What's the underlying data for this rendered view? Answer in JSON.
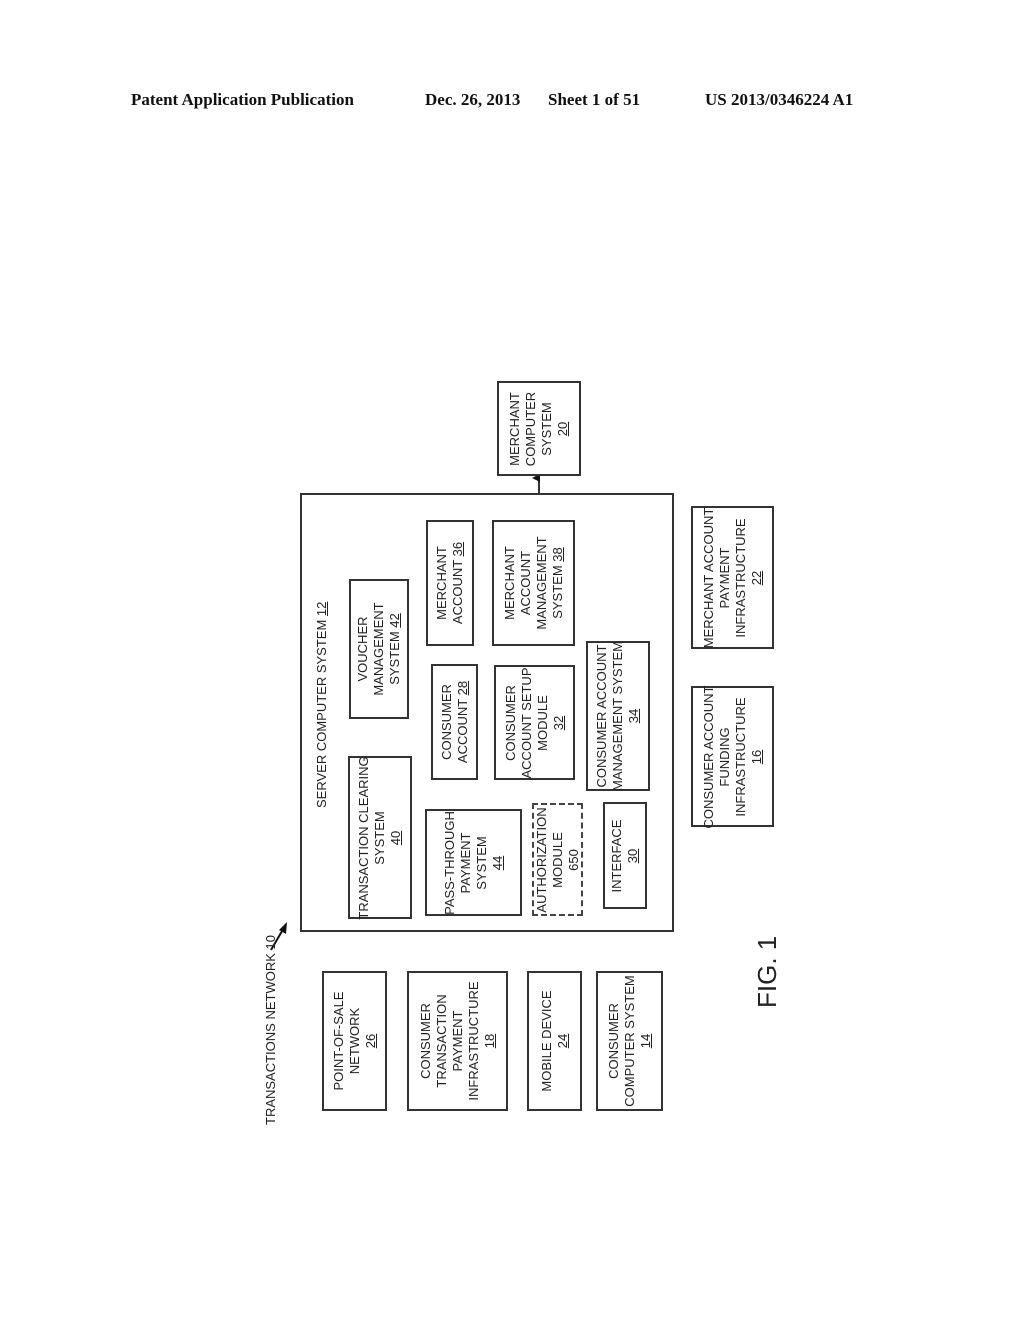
{
  "header": {
    "publication_type": "Patent Application Publication",
    "date": "Dec. 26, 2013",
    "sheet": "Sheet 1 of 51",
    "publication_number": "US 2013/0346224 A1"
  },
  "figure": {
    "label": "FIG. 1",
    "network_label": "TRANSACTIONS NETWORK 10",
    "server": {
      "title": "SERVER COMPUTER SYSTEM",
      "ref": "12",
      "components": {
        "transaction_clearing": {
          "lines": [
            "TRANSACTION CLEARING",
            "SYSTEM"
          ],
          "ref": "40"
        },
        "voucher_management": {
          "lines": [
            "VOUCHER",
            "MANAGEMENT",
            "SYSTEM"
          ],
          "ref": "42",
          "ref_inline": true
        },
        "merchant_account": {
          "lines": [
            "MERCHANT",
            "ACCOUNT"
          ],
          "ref": "36",
          "ref_inline": true
        },
        "consumer_account": {
          "lines": [
            "CONSUMER",
            "ACCOUNT"
          ],
          "ref": "28",
          "ref_inline": true
        },
        "pass_through_payment": {
          "lines": [
            "PASS-THROUGH",
            "PAYMENT",
            "SYSTEM"
          ],
          "ref": "44"
        },
        "authorization_module": {
          "lines": [
            "AUTHORIZATION",
            "MODULE"
          ],
          "ref": "650",
          "style": "dashed"
        },
        "merchant_account_management": {
          "lines": [
            "MERCHANT",
            "ACCOUNT",
            "MANAGEMENT",
            "SYSTEM"
          ],
          "ref": "38",
          "ref_inline": true
        },
        "consumer_account_setup": {
          "lines": [
            "CONSUMER",
            "ACCOUNT SETUP",
            "MODULE"
          ],
          "ref": "32"
        },
        "consumer_account_management": {
          "lines": [
            "CONSUMER ACCOUNT",
            "MANAGEMENT SYSTEM"
          ],
          "ref": "34"
        },
        "interface": {
          "lines": [
            "INTERFACE"
          ],
          "ref": "30"
        }
      }
    },
    "external": {
      "merchant_computer_system": {
        "lines": [
          "MERCHANT",
          "COMPUTER",
          "SYSTEM"
        ],
        "ref": "20"
      },
      "consumer_account_funding": {
        "lines": [
          "CONSUMER ACCOUNT",
          "FUNDING",
          "INFRASTRUCTURE"
        ],
        "ref": "16"
      },
      "merchant_account_payment": {
        "lines": [
          "MERCHANT ACCOUNT",
          "PAYMENT",
          "INFRASTRUCTURE"
        ],
        "ref": "22"
      },
      "point_of_sale_network": {
        "lines": [
          "POINT-OF-SALE",
          "NETWORK"
        ],
        "ref": "26"
      },
      "consumer_transaction_payment": {
        "lines": [
          "CONSUMER",
          "TRANSACTION",
          "PAYMENT",
          "INFRASTRUCTURE"
        ],
        "ref": "18"
      },
      "mobile_device": {
        "lines": [
          "MOBILE DEVICE"
        ],
        "ref": "24"
      },
      "consumer_computer_system": {
        "lines": [
          "CONSUMER",
          "COMPUTER SYSTEM"
        ],
        "ref": "14"
      }
    },
    "connections": [
      {
        "from": "merchant_account_management",
        "to": "merchant_computer_system",
        "arrow": "to"
      }
    ]
  }
}
